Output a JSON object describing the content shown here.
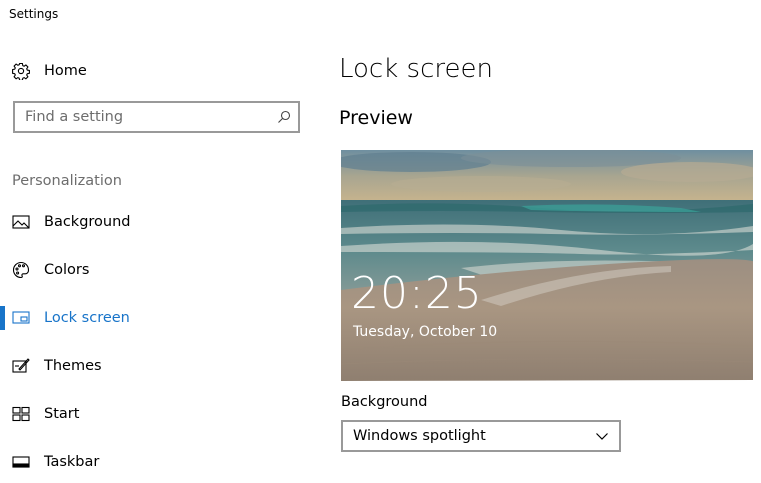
{
  "window": {
    "title": "Settings"
  },
  "sidebar": {
    "home_label": "Home",
    "search": {
      "placeholder": "Find a setting",
      "value": ""
    },
    "section_header": "Personalization",
    "items": [
      {
        "label": "Background",
        "icon": "picture-icon",
        "active": false
      },
      {
        "label": "Colors",
        "icon": "palette-icon",
        "active": false
      },
      {
        "label": "Lock screen",
        "icon": "lock-screen-icon",
        "active": true
      },
      {
        "label": "Themes",
        "icon": "themes-icon",
        "active": false
      },
      {
        "label": "Start",
        "icon": "start-icon",
        "active": false
      },
      {
        "label": "Taskbar",
        "icon": "taskbar-icon",
        "active": false
      }
    ]
  },
  "main": {
    "title": "Lock screen",
    "preview_heading": "Preview",
    "preview": {
      "time": "20:25",
      "date": "Tuesday, October 10"
    },
    "background_label": "Background",
    "background_value": "Windows spotlight"
  },
  "colors": {
    "accent": "#1874c9",
    "muted_text": "#6d6d6d",
    "border": "#999999"
  }
}
